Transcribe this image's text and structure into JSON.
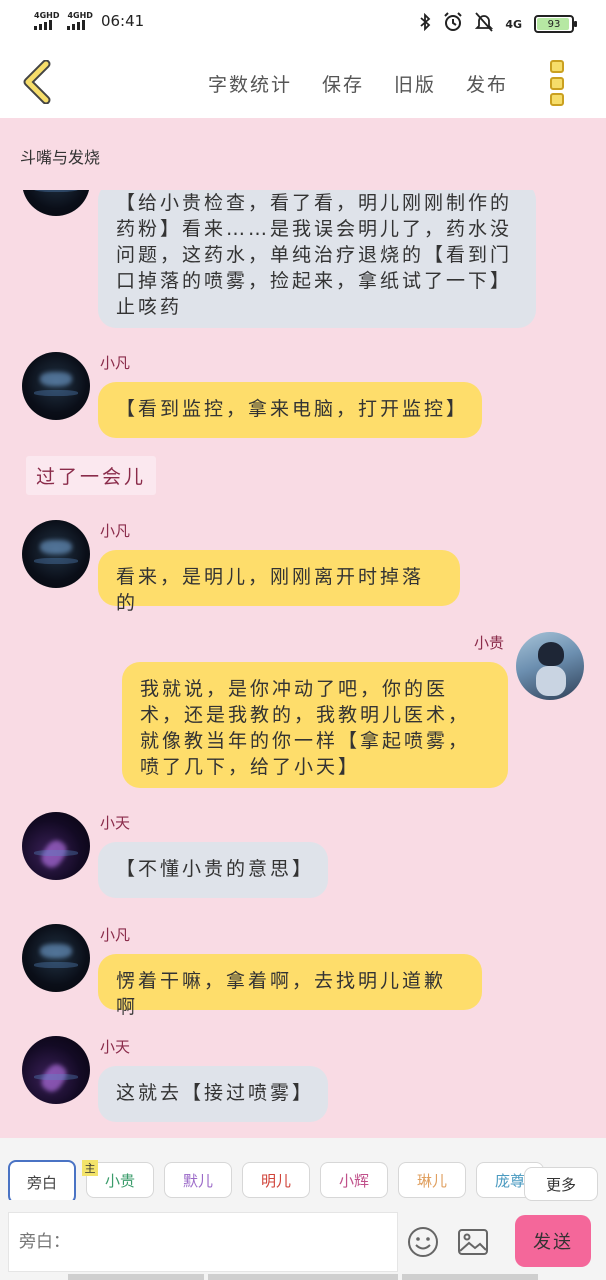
{
  "status_bar": {
    "network1": "4GHD",
    "network2": "4GHD",
    "time": "06:41",
    "network3": "4G",
    "battery": "93",
    "icons": [
      "bluetooth-icon",
      "alarm-icon",
      "mute-icon"
    ]
  },
  "toolbar": {
    "word_count": "字数统计",
    "save": "保存",
    "old_version": "旧版",
    "publish": "发布"
  },
  "chat": {
    "title": "斗嘴与发烧",
    "messages": [
      {
        "speaker": "",
        "text": "【给小贵检查，看了看，明儿刚刚制作的药粉】看来……是我误会明儿了，药水没问题，这药水，单纯治疗退烧的【看到门口掉落的喷雾，捡起来，拿纸试了一下】止咳药"
      },
      {
        "speaker": "小凡",
        "text": "【看到监控，拿来电脑，打开监控】"
      },
      {
        "speaker": "小凡",
        "text": "看来，是明儿，刚刚离开时掉落的"
      },
      {
        "speaker": "小贵",
        "text": "我就说，是你冲动了吧，你的医术，还是我教的，我教明儿医术，就像教当年的你一样【拿起喷雾，喷了几下，给了小天】"
      },
      {
        "speaker": "小天",
        "text": "【不懂小贵的意思】"
      },
      {
        "speaker": "小凡",
        "text": "愣着干嘛，拿着啊，去找明儿道歉啊"
      },
      {
        "speaker": "小天",
        "text": "这就去【接过喷雾】"
      }
    ],
    "narration": "过了一会儿"
  },
  "roles": {
    "host_badge": "主",
    "items": [
      "旁白",
      "小贵",
      "默儿",
      "明儿",
      "小辉",
      "琳儿",
      "庞尊"
    ],
    "colors": [
      "#444444",
      "#3a9b6a",
      "#9b6ac8",
      "#d0443a",
      "#c0508a",
      "#e0a060",
      "#4a9ac0"
    ],
    "more": "更多"
  },
  "composer": {
    "placeholder": "旁白：",
    "send": "发送"
  }
}
